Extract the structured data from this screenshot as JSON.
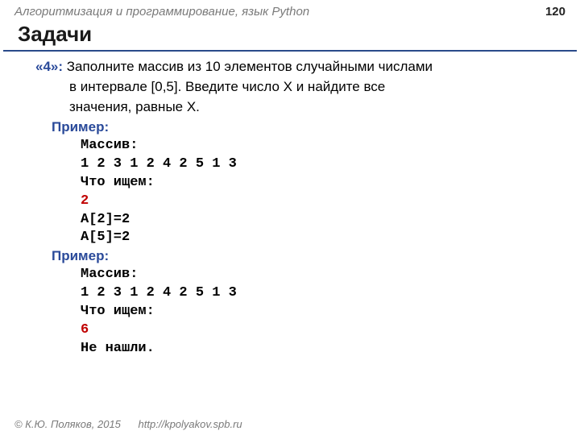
{
  "header": {
    "title": "Алгоритмизация и программирование, язык Python",
    "page": "120"
  },
  "section_title": "Задачи",
  "task": {
    "marker": "«4»:",
    "line1": "Заполните массив из 10 элементов случайными числами",
    "line2": "в интервале [0,5]. Введите число X и найдите все",
    "line3": "значения, равные X."
  },
  "ex1": {
    "label": "Пример:",
    "l1": "Массив:",
    "l2": "1 2 3 1 2 4 2 5 1 3",
    "l3": "Что ищем:",
    "l4": "2",
    "l5": "A[2]=2",
    "l6": "A[5]=2"
  },
  "ex2": {
    "label": "Пример:",
    "l1": "Массив:",
    "l2": "1 2 3 1 2 4 2 5 1 3",
    "l3": "Что ищем:",
    "l4": "6",
    "l5": "Не нашли."
  },
  "footer": {
    "copyright": "© К.Ю. Поляков, 2015",
    "link": "http://kpolyakov.spb.ru"
  }
}
